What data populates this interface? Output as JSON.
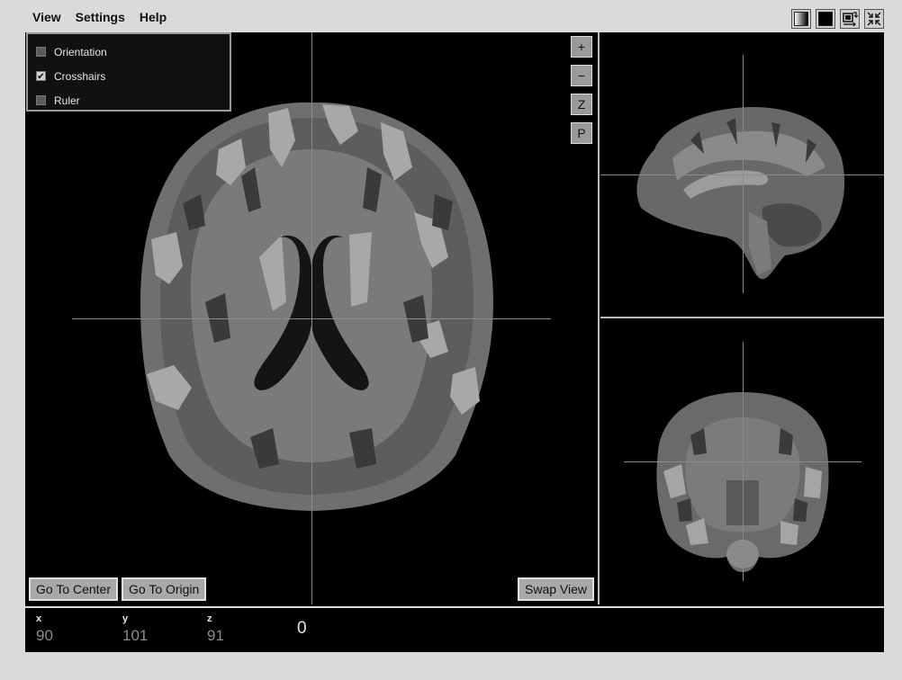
{
  "menu": {
    "items": [
      "View",
      "Settings",
      "Help"
    ]
  },
  "toolbar": {
    "icons": [
      "grayscale-gradient-icon",
      "black-background-icon",
      "swap-layout-icon",
      "collapse-icon"
    ]
  },
  "overlay": {
    "orientation": {
      "label": "Orientation",
      "checked": false
    },
    "crosshairs": {
      "label": "Crosshairs",
      "checked": true
    },
    "ruler": {
      "label": "Ruler",
      "checked": false
    }
  },
  "zoom": {
    "zoom_in": "+",
    "zoom_out": "−",
    "z_label": "Z",
    "p_label": "P"
  },
  "buttons": {
    "go_to_center": "Go To Center",
    "go_to_origin": "Go To Origin",
    "swap_view": "Swap View"
  },
  "status": {
    "x_label": "x",
    "x_value": "90",
    "y_label": "y",
    "y_value": "101",
    "z_label": "z",
    "z_value": "91",
    "intensity": "0"
  },
  "colors": {
    "background": "#dadada",
    "viewer_bg": "#000000",
    "crosshair": "#8a8a8a"
  }
}
